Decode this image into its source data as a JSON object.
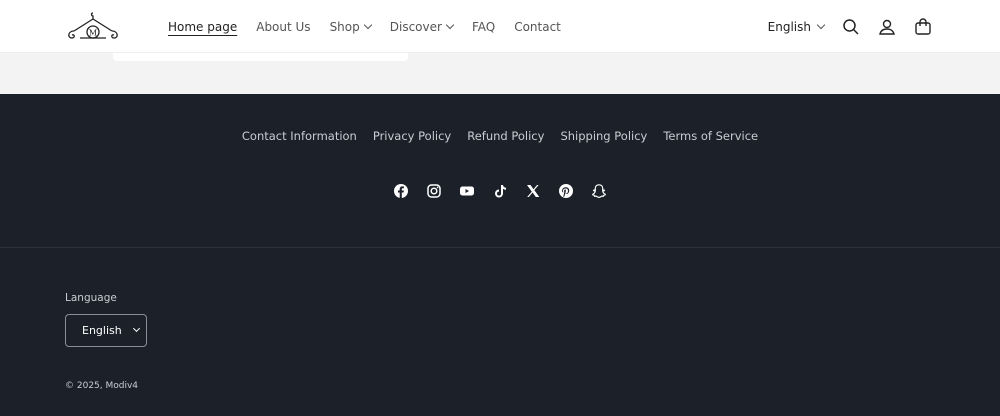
{
  "header": {
    "logo_letter": "M",
    "nav": [
      {
        "label": "Home page"
      },
      {
        "label": "About Us"
      },
      {
        "label": "Shop"
      },
      {
        "label": "Discover"
      },
      {
        "label": "FAQ"
      },
      {
        "label": "Contact"
      }
    ],
    "language": "English"
  },
  "footer": {
    "links": [
      "Contact Information",
      "Privacy Policy",
      "Refund Policy",
      "Shipping Policy",
      "Terms of Service"
    ],
    "socials": [
      "facebook",
      "instagram",
      "youtube",
      "tiktok",
      "x",
      "pinterest",
      "snapchat"
    ],
    "language_label": "Language",
    "language_value": "English",
    "copyright": "© 2025, Modiv4"
  }
}
